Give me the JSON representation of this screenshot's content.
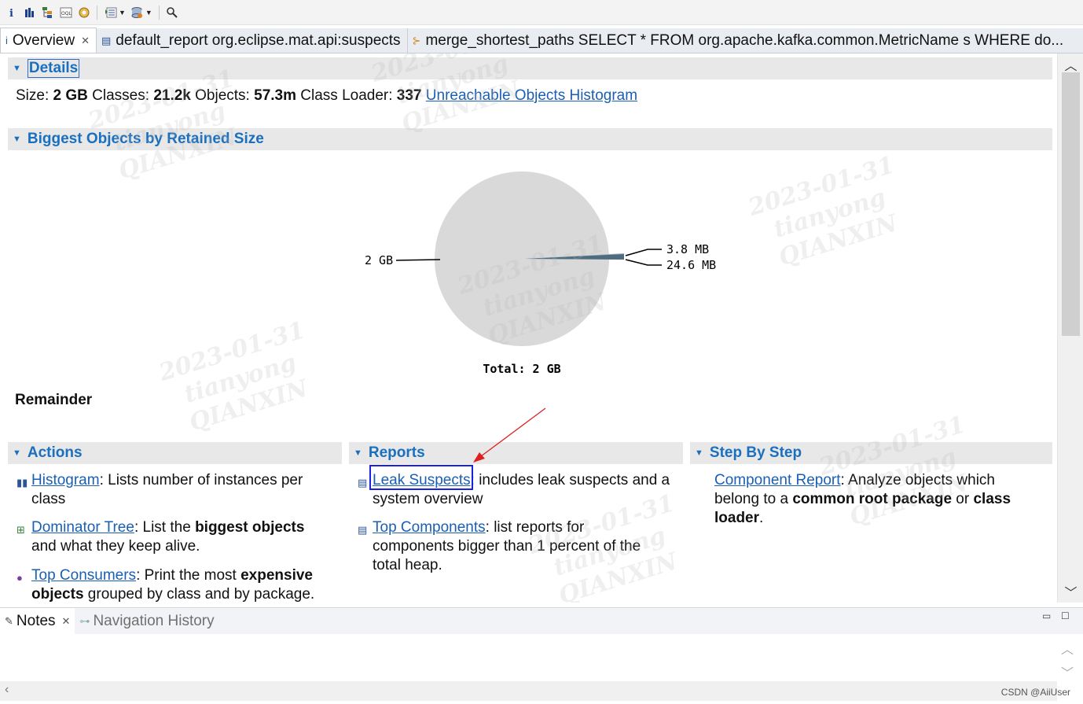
{
  "toolbar": {
    "icons": [
      "info-icon",
      "histogram-icon",
      "dominator-tree-icon",
      "oql-icon",
      "heap-dump-details-icon",
      "query-browser-icon",
      "dropdown-icon",
      "find-object-icon",
      "dropdown-icon",
      "search-icon"
    ]
  },
  "editor_tabs": [
    {
      "label": "Overview",
      "icon": "info-icon",
      "active": true
    },
    {
      "label": "default_report  org.eclipse.mat.api:suspects",
      "icon": "report-icon"
    },
    {
      "label": "merge_shortest_paths  SELECT * FROM org.apache.kafka.common.MetricName s WHERE do...",
      "icon": "query-icon"
    }
  ],
  "details": {
    "title": "Details",
    "size_label": "Size:",
    "size_value": "2 GB",
    "classes_label": "Classes:",
    "classes_value": "21.2k",
    "objects_label": "Objects:",
    "objects_value": "57.3m",
    "loader_label": "Class Loader:",
    "loader_value": "337",
    "unreachable_link": "Unreachable Objects Histogram"
  },
  "biggest_objects": {
    "title": "Biggest Objects by Retained Size",
    "remainder_label": "Remainder"
  },
  "chart_data": {
    "type": "pie",
    "labels": [
      "2 GB",
      "3.8 MB",
      "24.6 MB"
    ],
    "values_mb": [
      2048,
      3.8,
      24.6
    ],
    "total_label": "Total: 2 GB",
    "colors": [
      "#d9d9d9",
      "#a9b7c2",
      "#4f6b7e"
    ]
  },
  "actions": {
    "title": "Actions",
    "items": [
      {
        "link": "Histogram",
        "text_1": ": Lists number of instances per",
        "text_2": "class"
      },
      {
        "link": "Dominator Tree",
        "text_1": ": List the ",
        "bold_1": "biggest objects",
        "text_2": "and what they keep alive."
      },
      {
        "link": "Top Consumers",
        "text_1": ": Print the most ",
        "bold_1": "expensive",
        "bold_2": "objects",
        "text_2": " grouped by class and by package."
      }
    ]
  },
  "reports": {
    "title": "Reports",
    "items": [
      {
        "link": "Leak Suspects",
        "text_1": ": includes leak suspects and a",
        "text_2": "system overview"
      },
      {
        "link": "Top Components",
        "text_1": ": list reports for",
        "text_2": "components bigger than 1 percent of the",
        "text_3": "total heap."
      }
    ]
  },
  "step_by_step": {
    "title": "Step By Step",
    "items": [
      {
        "link": "Component Report",
        "text_1": ": Analyze objects which",
        "text_2a": "belong to a ",
        "bold_1": "common root package",
        "text_2b": " or ",
        "bold_2": "class",
        "bold_3": "loader",
        "text_3": "."
      }
    ]
  },
  "bottom_panel": {
    "tabs": [
      {
        "label": "Notes",
        "active": true
      },
      {
        "label": "Navigation History",
        "active": false
      }
    ]
  },
  "watermark": {
    "text": "2023-01-31\ntianyong\nQIANXIN",
    "credit": "CSDN @AiiUser"
  },
  "annotation": {
    "arrow_color": "#e02020",
    "box_color": "#1a22e0"
  }
}
